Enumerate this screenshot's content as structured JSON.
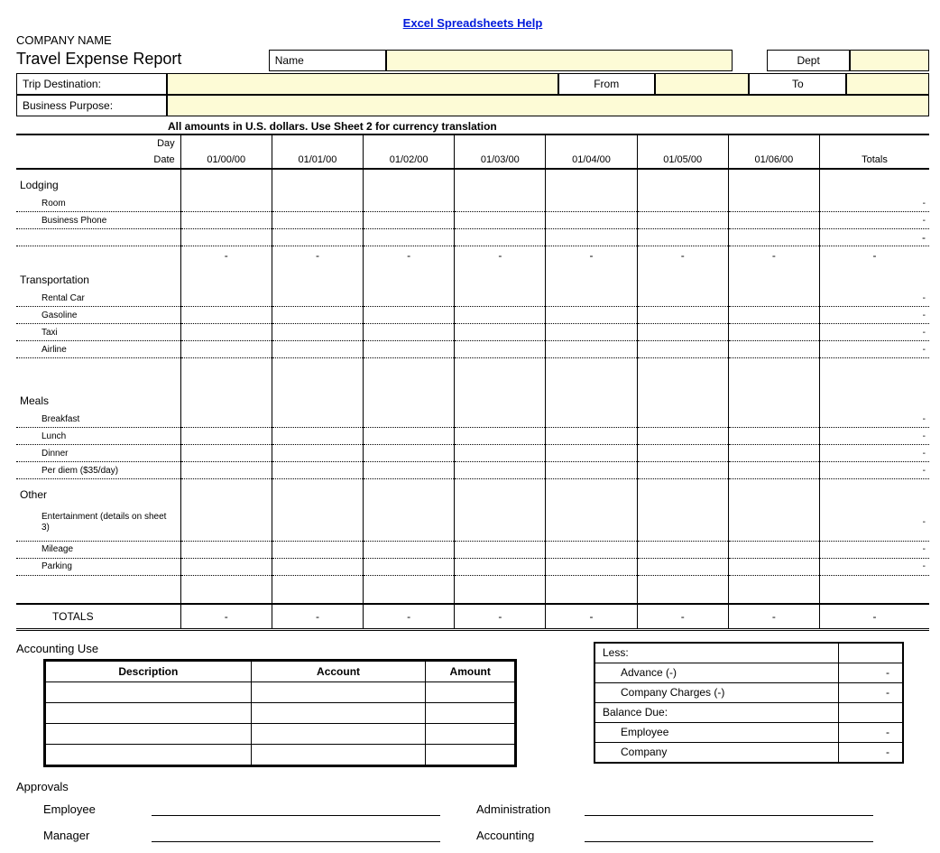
{
  "link": "Excel Spreadsheets Help",
  "company": "COMPANY NAME",
  "title": "Travel Expense Report",
  "header": {
    "name_label": "Name",
    "dept_label": "Dept",
    "trip_dest_label": "Trip Destination:",
    "from_label": "From",
    "to_label": "To",
    "purpose_label": "Business Purpose:"
  },
  "note": "All amounts in U.S. dollars.  Use Sheet 2 for currency translation",
  "grid": {
    "day_label": "Day",
    "date_label": "Date",
    "dates": [
      "01/00/00",
      "01/01/00",
      "01/02/00",
      "01/03/00",
      "01/04/00",
      "01/05/00",
      "01/06/00"
    ],
    "totals_label": "Totals"
  },
  "sections": {
    "lodging": {
      "label": "Lodging",
      "items": [
        "Room",
        "Business Phone"
      ]
    },
    "transport": {
      "label": "Transportation",
      "items": [
        "Rental Car",
        "Gasoline",
        "Taxi",
        "Airline"
      ]
    },
    "meals": {
      "label": "Meals",
      "items": [
        "Breakfast",
        "Lunch",
        "Dinner"
      ],
      "perdiem": "Per diem ($35/day)"
    },
    "other": {
      "label": "Other",
      "items": [
        "Entertainment (details on sheet 3)",
        "Mileage",
        "Parking"
      ]
    },
    "totals_label": "TOTALS"
  },
  "dash": "-",
  "accounting": {
    "title": "Accounting Use",
    "headers": {
      "desc": "Description",
      "acct": "Account",
      "amt": "Amount"
    }
  },
  "less": {
    "title": "Less:",
    "advance": "Advance (-)",
    "charges": "Company Charges (-)",
    "balance": "Balance Due:",
    "employee": "Employee",
    "company": "Company"
  },
  "approvals": {
    "title": "Approvals",
    "employee": "Employee",
    "manager": "Manager",
    "admin": "Administration",
    "acct": "Accounting"
  }
}
